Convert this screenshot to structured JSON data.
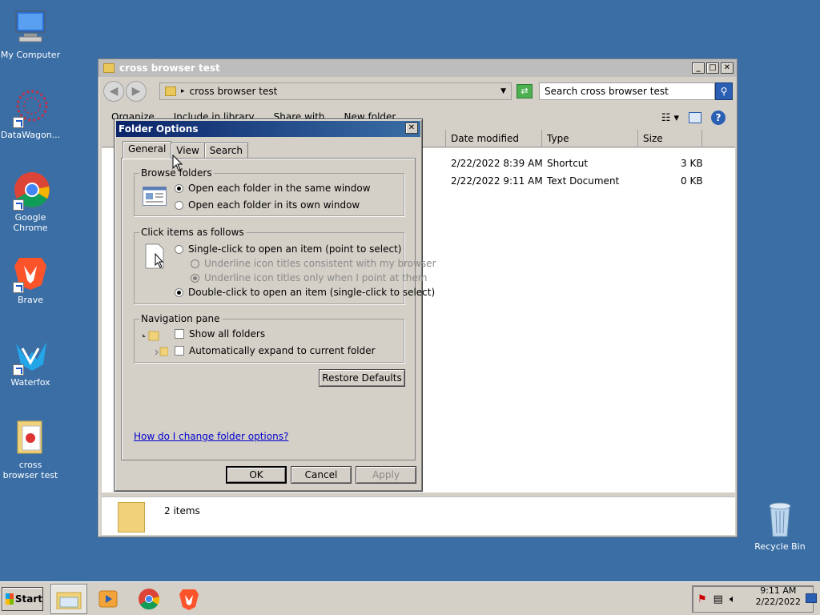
{
  "desktop": {
    "icons": [
      {
        "label": "My Computer"
      },
      {
        "label": "DataWagon..."
      },
      {
        "label": "Google Chrome"
      },
      {
        "label": "Brave"
      },
      {
        "label": "Waterfox"
      },
      {
        "label": "cross browser test"
      },
      {
        "label": "Recycle Bin"
      }
    ]
  },
  "explorer": {
    "title": "cross browser test",
    "address": "cross browser test",
    "search_placeholder": "Search cross browser test",
    "toolbar": {
      "organize": "Organize",
      "include": "Include in library",
      "share": "Share with",
      "new_folder": "New folder"
    },
    "columns": {
      "date": "Date modified",
      "type": "Type",
      "size": "Size"
    },
    "files": [
      {
        "date": "2/22/2022 8:39 AM",
        "type": "Shortcut",
        "size": "3 KB"
      },
      {
        "date": "2/22/2022 9:11 AM",
        "type": "Text Document",
        "size": "0 KB"
      }
    ],
    "status": "2 items"
  },
  "dialog": {
    "title": "Folder Options",
    "tabs": [
      "General",
      "View",
      "Search"
    ],
    "browse_folders": {
      "title": "Browse folders",
      "opt1": "Open each folder in the same window",
      "opt2": "Open each folder in its own window"
    },
    "click_items": {
      "title": "Click items as follows",
      "single": "Single-click to open an item (point to select)",
      "underline1": "Underline icon titles consistent with my browser",
      "underline2": "Underline icon titles only when I point at them",
      "double": "Double-click to open an item (single-click to select)"
    },
    "nav_pane": {
      "title": "Navigation pane",
      "show_all": "Show all folders",
      "auto_expand": "Automatically expand to current folder"
    },
    "restore": "Restore Defaults",
    "help_link": "How do I change folder options?",
    "ok": "OK",
    "cancel": "Cancel",
    "apply": "Apply"
  },
  "taskbar": {
    "start": "Start",
    "time": "9:11 AM",
    "date": "2/22/2022"
  }
}
